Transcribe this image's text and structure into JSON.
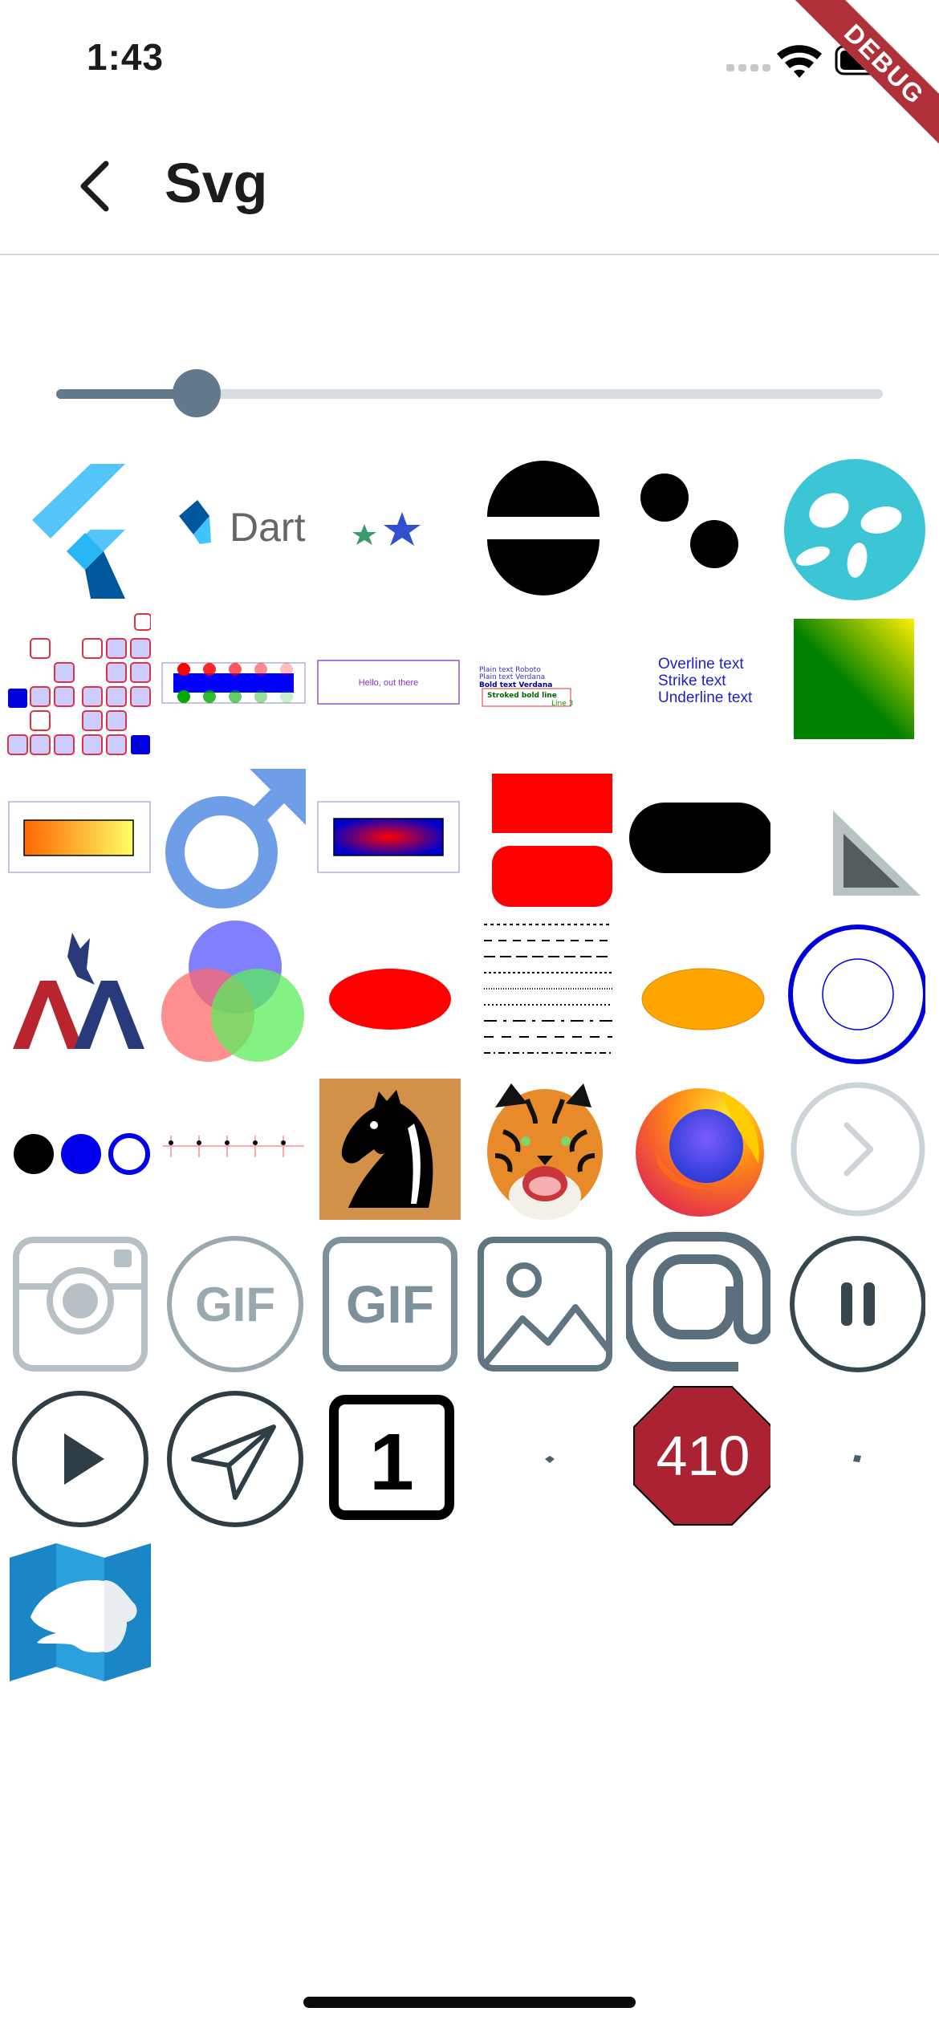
{
  "status_bar": {
    "time": "1:43",
    "debug_label": "DEBUG"
  },
  "app_bar": {
    "title": "Svg",
    "back_icon": "chevron-left-icon"
  },
  "slider": {
    "value_fraction": 0.17
  },
  "colors": {
    "accent": "#61798a",
    "track": "#d6dcdf",
    "debug": "#b0303a"
  },
  "tiles": [
    {
      "icon": "flutter-logo-icon"
    },
    {
      "icon": "dart-logo-icon",
      "text": "Dart"
    },
    {
      "icon": "stars-icon"
    },
    {
      "icon": "split-circle-icon"
    },
    {
      "icon": "two-dots-icon"
    },
    {
      "icon": "cyan-blob-icon"
    },
    {
      "icon": "rect-pattern-icon"
    },
    {
      "icon": "bar-circles-icon"
    },
    {
      "icon": "text-box-icon",
      "text": "Hello, out there"
    },
    {
      "icon": "text-fonts-icon",
      "lines": [
        "Plain text Roboto",
        "Plain text Verdana",
        "Bold text Verdana",
        "Stroked bold line",
        "Line 3"
      ]
    },
    {
      "icon": "text-decoration-icon",
      "lines": [
        "Overline text",
        "Strike text",
        "Underline text"
      ]
    },
    {
      "icon": "gradient-square-icon"
    },
    {
      "icon": "linear-gradient-rect-icon"
    },
    {
      "icon": "male-symbol-icon"
    },
    {
      "icon": "radial-gradient-rect-icon"
    },
    {
      "icon": "red-rects-icon"
    },
    {
      "icon": "black-pill-icon"
    },
    {
      "icon": "triangle-icon"
    },
    {
      "icon": "american-airlines-logo-icon"
    },
    {
      "icon": "venn-circles-icon"
    },
    {
      "icon": "red-ellipse-icon"
    },
    {
      "icon": "dashed-lines-icon"
    },
    {
      "icon": "orange-ellipse-icon"
    },
    {
      "icon": "blue-rings-icon"
    },
    {
      "icon": "three-circles-icon"
    },
    {
      "icon": "tick-line-icon"
    },
    {
      "icon": "chess-knight-icon"
    },
    {
      "icon": "tiger-icon"
    },
    {
      "icon": "firefox-logo-icon"
    },
    {
      "icon": "chevron-circle-icon"
    },
    {
      "icon": "instagram-icon"
    },
    {
      "icon": "gif-circle-icon",
      "text": "GIF"
    },
    {
      "icon": "gif-square-icon",
      "text": "GIF"
    },
    {
      "icon": "image-icon"
    },
    {
      "icon": "at-sign-icon"
    },
    {
      "icon": "pause-circle-icon"
    },
    {
      "icon": "play-circle-icon"
    },
    {
      "icon": "send-circle-icon"
    },
    {
      "icon": "number-one-icon",
      "text": "1"
    },
    {
      "icon": "small-dot-icon"
    },
    {
      "icon": "stop-sign-icon",
      "text": "410"
    },
    {
      "icon": "small-dot-icon"
    },
    {
      "icon": "map-bear-icon"
    }
  ]
}
